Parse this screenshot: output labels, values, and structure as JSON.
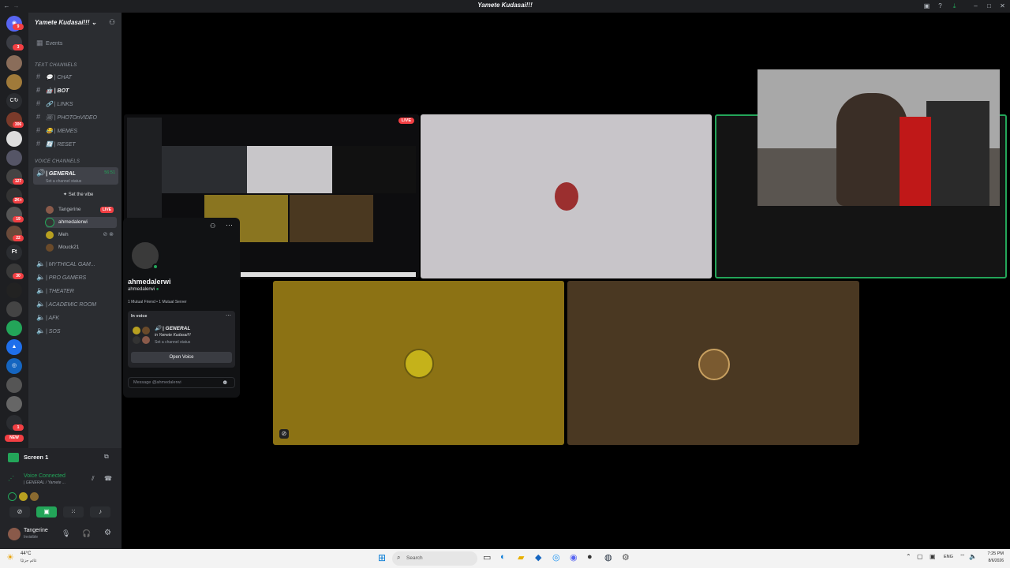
{
  "window": {
    "title": "Yamete Kudasai!!!"
  },
  "server": {
    "name": "Yamete Kudasai!!!",
    "events_label": "Events",
    "text_category": "TEXT CHANNELS",
    "text_channels": [
      "| CHAT",
      "| BOT",
      "| LINKS",
      "| PHOTOnVIDEO",
      "| MEMES",
      "| RESET"
    ],
    "voice_category": "VOICE CHANNELS",
    "active_voice": {
      "name": "| GENERAL",
      "timer": "56:51",
      "status": "Set a channel status"
    },
    "set_vibe": "Set the vibe",
    "voice_users": [
      {
        "name": "Tangerine",
        "live": "LIVE"
      },
      {
        "name": "ahmedalerwi",
        "live": ""
      },
      {
        "name": "Meh",
        "live": ""
      },
      {
        "name": "Mouck21",
        "live": ""
      }
    ],
    "voice_channels": [
      "| MYTHICAL GAM...",
      "| PRO GAMERS",
      "| THEATER",
      "| ACADEMIC ROOM",
      "| AFK",
      "| SOS"
    ]
  },
  "server_badges": [
    "9",
    "3",
    "306",
    "127",
    "2K+",
    "19",
    "22",
    "30",
    "1"
  ],
  "server_letters": [
    "Ft"
  ],
  "new_badge": "NEW",
  "screen_panel": {
    "label": "Screen 1"
  },
  "voice_status": {
    "title": "Voice Connected",
    "channel": "| GENERAL / Yamete ..."
  },
  "user_panel": {
    "name": "Tangerine",
    "status": "Invisible"
  },
  "stage": {
    "live_badge": "LIVE"
  },
  "profile": {
    "display_name": "ahmedalerwi",
    "username": "ahmedalerwi",
    "mutuals": "1 Mutual Friend • 1 Mutual Server",
    "in_voice_label": "In voice",
    "voice_channel": "| GENERAL",
    "voice_server": "in Yamete Kudasai!!!",
    "voice_status": "Set a channel status",
    "open_voice": "Open Voice",
    "message_placeholder": "Message @ahmedalerwi"
  },
  "taskbar": {
    "weather_temp": "44°C",
    "weather_desc": "غائم جزئيًا",
    "search_placeholder": "Search",
    "language": "ENG",
    "time": "7:25 PM",
    "date": "8/6/2026"
  },
  "colors": {
    "accent": "#23a559",
    "live": "#f23f43",
    "brand": "#5865f2"
  }
}
